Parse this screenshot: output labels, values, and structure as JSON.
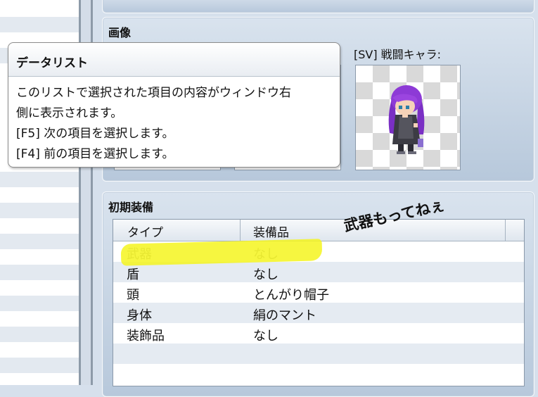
{
  "image_panel": {
    "title": "画像",
    "sv_label": "[SV] 戦闘キャラ:"
  },
  "tooltip": {
    "title": "データリスト",
    "lines": [
      "このリストで選択された項目の内容がウィンドウ右",
      "側に表示されます。",
      "[F5] 次の項目を選択します。",
      "[F4] 前の項目を選択します。"
    ]
  },
  "equipment_panel": {
    "title": "初期装備",
    "columns": [
      "タイプ",
      "装備品"
    ],
    "rows": [
      {
        "type": "武器",
        "item": "なし"
      },
      {
        "type": "盾",
        "item": "なし"
      },
      {
        "type": "頭",
        "item": "とんがり帽子"
      },
      {
        "type": "身体",
        "item": "絹のマント"
      },
      {
        "type": "装飾品",
        "item": "なし"
      }
    ]
  },
  "annotation": {
    "note": "武器もってねぇ",
    "highlight_color": "#f5f51e"
  },
  "colors": {
    "panel_top": "#d9e3ee",
    "panel_bottom": "#b7c8db",
    "row_alt": "#e5ebf2"
  }
}
